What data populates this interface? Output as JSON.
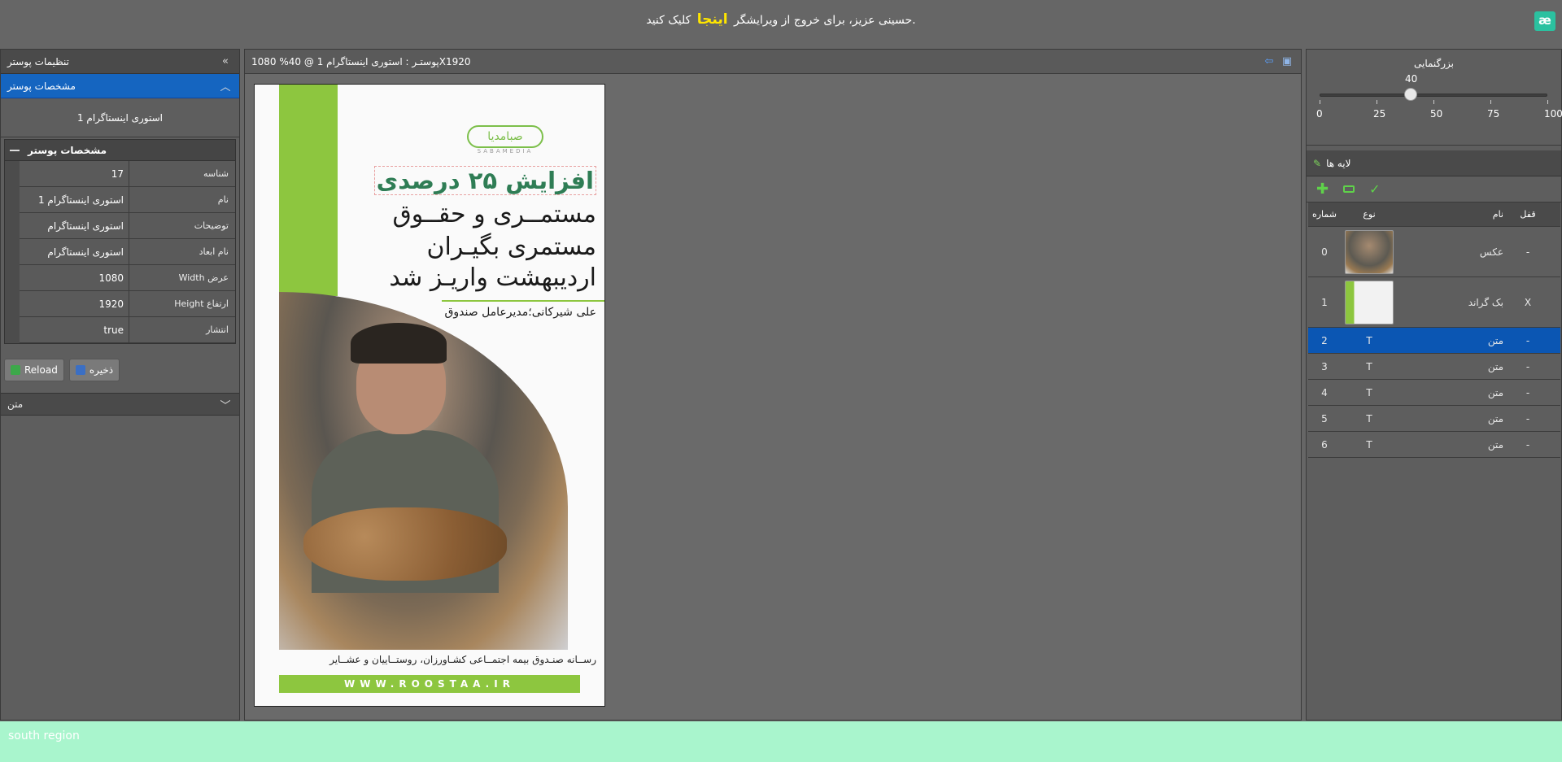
{
  "top": {
    "message_before": "حسینی عزیز، برای خروج از ویرایشگر",
    "link": "اینجا",
    "message_after": "کلیک کنید.",
    "logo": "æ"
  },
  "settings": {
    "title": "تنظیمات پوستر",
    "section_title": "مشخصات پوستر",
    "poster_name": "استوری اینستاگرام 1",
    "props_title": "مشخصات پوستر",
    "rows": [
      {
        "key": "شناسه",
        "value": "17"
      },
      {
        "key": "نام",
        "value": "استوری اینستاگرام 1"
      },
      {
        "key": "توضیحات",
        "value": "استوری اینستاگرام"
      },
      {
        "key": "نام ابعاد",
        "value": "استوری اینستاگرام"
      },
      {
        "key": "Width عرض",
        "value": "1080"
      },
      {
        "key": "Height ارتفاع",
        "value": "1920"
      },
      {
        "key": "انتشار",
        "value": "true"
      }
    ],
    "reload_label": "Reload",
    "save_label": "ذخیره",
    "text_section": "متن"
  },
  "editor": {
    "title": "پوستـر : استوری اینستاگرام 1 @ 40% 1080X1920"
  },
  "poster": {
    "logo_text": "صبامدیا",
    "logo_sub": "SABAMEDIA",
    "headline": "افزایش ۲۵ درصدی",
    "line1": "مستمــری و حقــوق",
    "line2": "مستمری بگیـران",
    "line3": "اردیبهشت واریـز شد",
    "author": "علی شیرکانی؛مدیرعامل صندوق",
    "footer": "رســانه صنـدوق بیمه اجتمــاعی کشـاورزان، روستــاییان و عشــایر",
    "url": "WWW.ROOSTAA.IR"
  },
  "zoom": {
    "title": "بزرگنمایی",
    "value": "40",
    "ticks": [
      "0",
      "25",
      "50",
      "75",
      "100"
    ]
  },
  "layers": {
    "title": "لایه ها",
    "columns": {
      "lock": "قفل",
      "name": "نام",
      "type": "نوع",
      "num": "شماره"
    },
    "rows": [
      {
        "lock": "-",
        "name": "عکس",
        "type": "image",
        "num": "0"
      },
      {
        "lock": "X",
        "name": "بک گراند",
        "type": "image",
        "num": "1"
      },
      {
        "lock": "-",
        "name": "متن",
        "type": "T",
        "num": "2",
        "selected": true
      },
      {
        "lock": "-",
        "name": "متن",
        "type": "T",
        "num": "3"
      },
      {
        "lock": "-",
        "name": "متن",
        "type": "T",
        "num": "4"
      },
      {
        "lock": "-",
        "name": "متن",
        "type": "T",
        "num": "5"
      },
      {
        "lock": "-",
        "name": "متن",
        "type": "T",
        "num": "6"
      }
    ]
  },
  "south": {
    "label": "south region"
  },
  "colors": {
    "accent_blue": "#1565c0",
    "brand_green": "#8dc63f",
    "link_yellow": "#ffe600",
    "south_bg": "#a9f5cd"
  }
}
